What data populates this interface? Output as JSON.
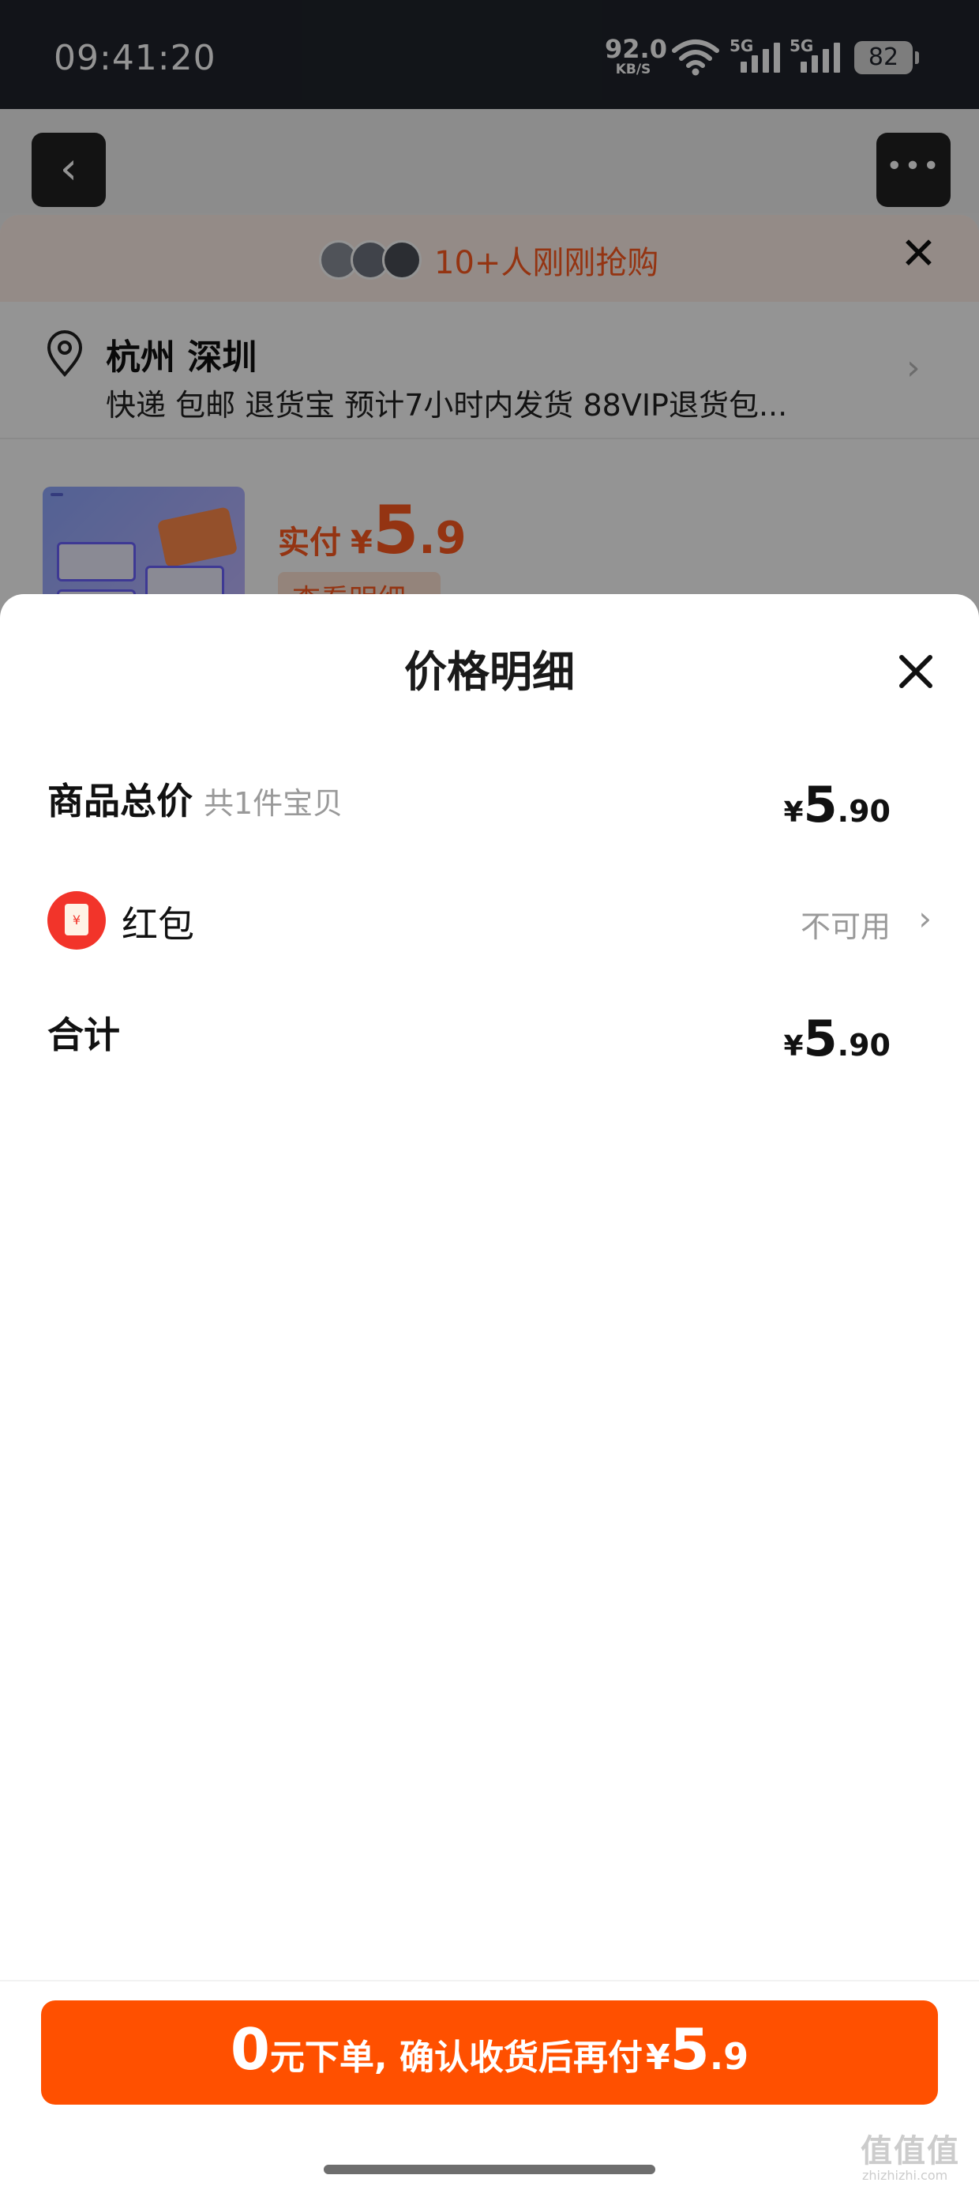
{
  "status_bar": {
    "time": "09:41:20",
    "net_speed": "92.0",
    "net_unit": "KB/S",
    "signal_1": "5G",
    "signal_2": "5G",
    "battery": "82"
  },
  "background": {
    "buyers_text": "10+人刚刚抢购",
    "address": {
      "city": "杭州 深圳",
      "desc": "快递 包邮 退货宝 预计7小时内发货 88VIP退货包..."
    },
    "product": {
      "paid_label": "实付",
      "currency": "¥",
      "price_int": "5",
      "price_dec": ".9",
      "view_detail": "查看明细"
    }
  },
  "sheet": {
    "title": "价格明细",
    "rows": {
      "goods_total": {
        "label": "商品总价",
        "sub": "共1件宝贝",
        "currency": "¥",
        "int": "5",
        "dec": ".90"
      },
      "red_packet": {
        "label": "红包",
        "status": "不可用"
      },
      "sum": {
        "label": "合计",
        "currency": "¥",
        "int": "5",
        "dec": ".90"
      }
    }
  },
  "footer": {
    "order_button": {
      "zero": "0",
      "text": "元下单, 确认收货后再付",
      "currency": "¥",
      "amount_int": "5",
      "amount_dec": ".9"
    },
    "watermark": "值值值",
    "watermark_sub": "zhizhizhi.com"
  },
  "colors": {
    "accent": "#ff5000",
    "price_orange": "#ff5a1f",
    "red_packet": "#f2342a",
    "status_bar": "#1f242b"
  }
}
